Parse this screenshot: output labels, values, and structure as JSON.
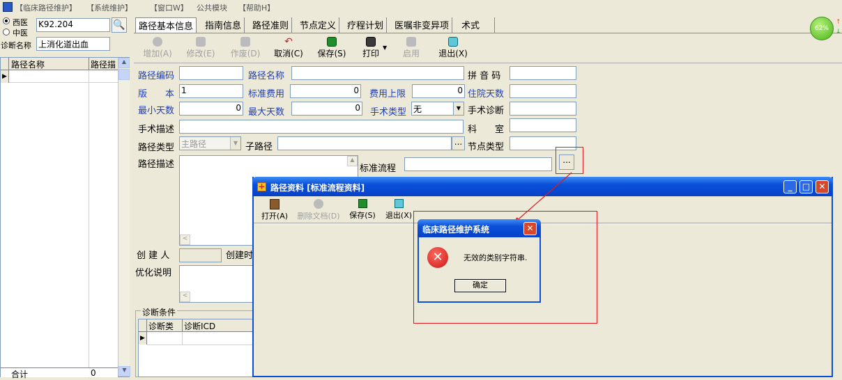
{
  "menubar": {
    "items": [
      "【临床路径维护】",
      "【系统维护】",
      "【窗口W】",
      "公共模块",
      "【帮助H】"
    ]
  },
  "left_panel": {
    "radio_west": "西医",
    "radio_chinese": "中医",
    "code_value": "K92.204",
    "diagnosis_label": "诊断名称",
    "diagnosis_value": "上消化道出血",
    "grid_headers": [
      "路径名称",
      "路径描"
    ],
    "total_label": "合计",
    "total_value": "0"
  },
  "tabs": [
    "路径基本信息",
    "指南信息",
    "路径准则",
    "节点定义",
    "疗程计划",
    "医嘱非变异项",
    "术式"
  ],
  "toolbar": {
    "add": "增加(A)",
    "edit": "修改(E)",
    "void": "作废(D)",
    "cancel": "取消(C)",
    "save": "保存(S)",
    "print": "打印",
    "enable": "启用",
    "exit": "退出(X)"
  },
  "form": {
    "path_code_label": "路径编码",
    "path_name_label": "路径名称",
    "pinyin_label": "拼 音 码",
    "version_label": "版　　本",
    "version_value": "1",
    "std_cost_label": "标准费用",
    "std_cost_value": "0",
    "cost_limit_label": "费用上限",
    "cost_limit_value": "0",
    "stay_days_label": "住院天数",
    "min_days_label": "最小天数",
    "min_days_value": "0",
    "max_days_label": "最大天数",
    "max_days_value": "0",
    "surgery_type_label": "手术类型",
    "surgery_type_value": "无",
    "surgery_diag_label": "手术诊断",
    "surgery_desc_label": "手术描述",
    "dept_label": "科　　室",
    "path_type_label": "路径类型",
    "path_type_value": "主路径",
    "sub_path_label": "子路径",
    "node_type_label": "节点类型",
    "path_desc_label": "路径描述",
    "std_flow_label": "标准流程",
    "creator_label": "创 建 人",
    "create_time_label": "创建时",
    "optimize_label": "优化说明",
    "diag_cond_label": "诊断条件",
    "diag_cond_headers": [
      "诊断类",
      "诊断ICD"
    ],
    "ellipsis": "..."
  },
  "status_badge": {
    "percent": "62%"
  },
  "child_window": {
    "title": "路径资料 [标准流程资料]",
    "open": "打开(A)",
    "delete_doc": "删除文档(D)",
    "save": "保存(S)",
    "exit": "退出(X)"
  },
  "dialog": {
    "title": "临床路径维护系统",
    "message": "无效的类别字符串.",
    "ok_button": "确定"
  },
  "colors": {
    "title_blue": "#0a4fd8",
    "label_blue": "#1f3fb8",
    "error_red": "#d8262c",
    "highlight_red": "#e0191e"
  }
}
